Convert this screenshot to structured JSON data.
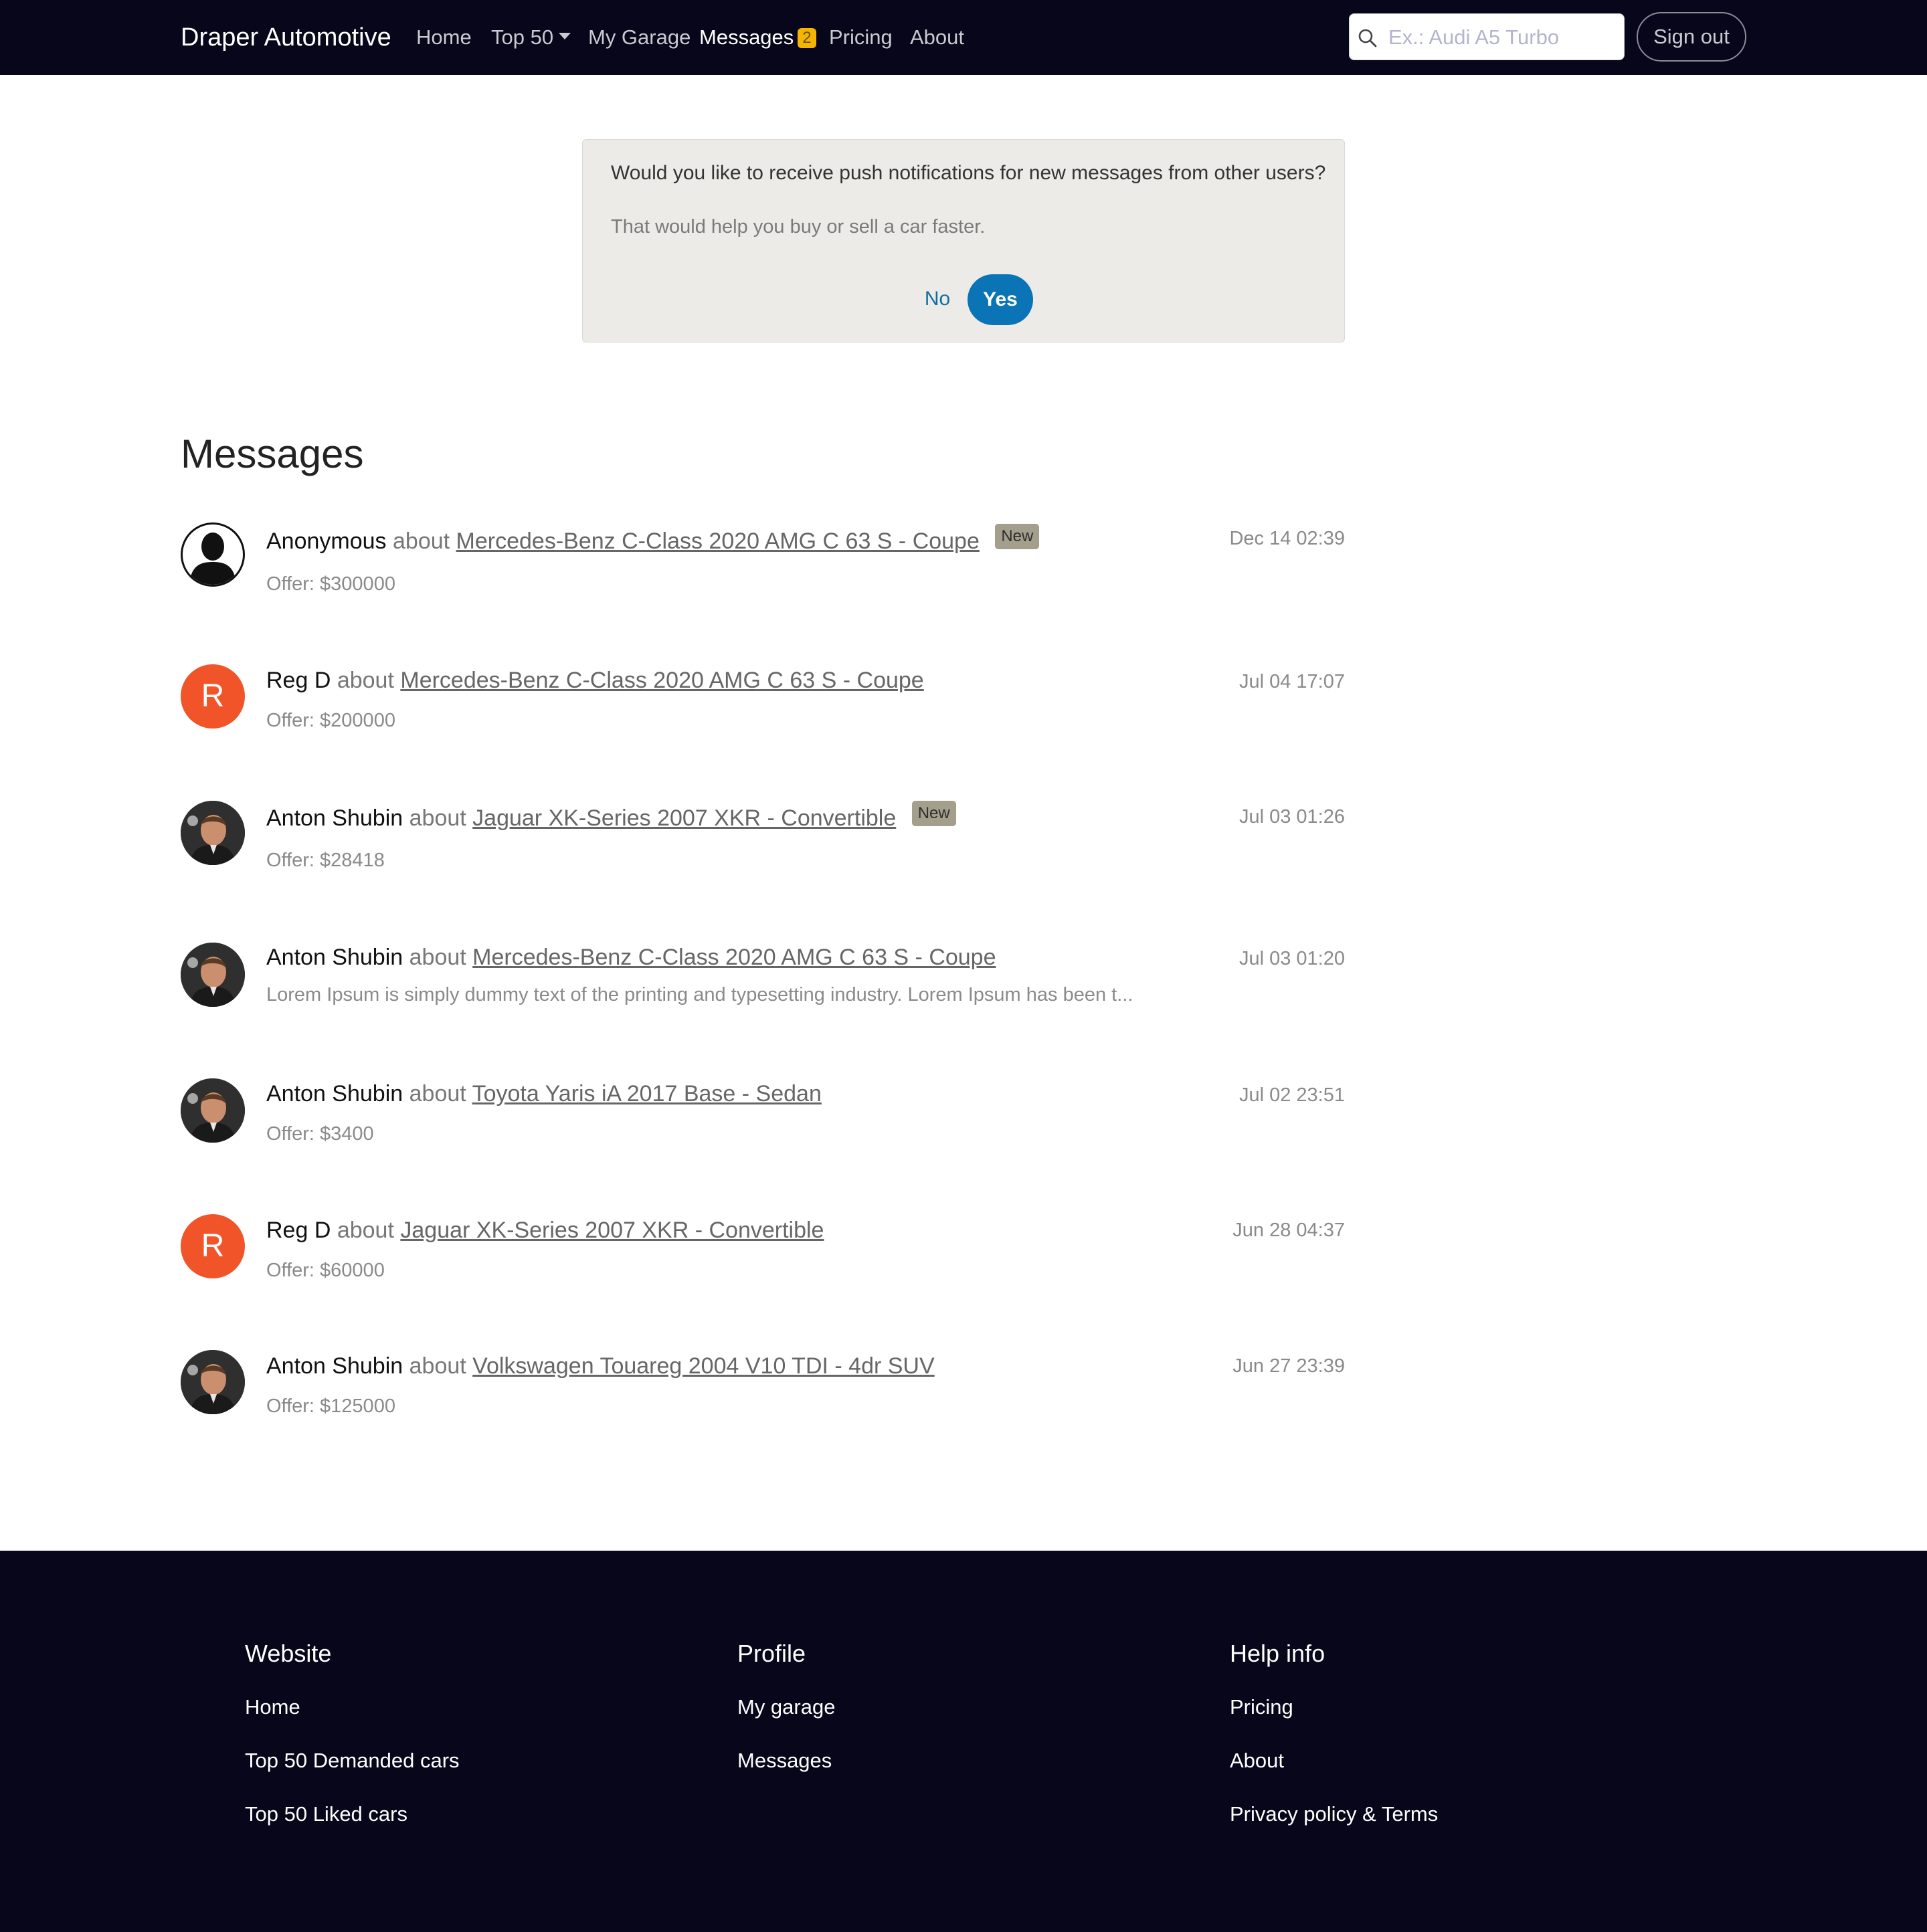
{
  "navbar": {
    "brand": "Draper Automotive",
    "links": [
      "Home",
      "Top 50",
      "My Garage",
      "Messages",
      "Pricing",
      "About"
    ],
    "messages_badge": "2",
    "search_placeholder": "Ex.: Audi A5 Turbo",
    "signout_label": "Sign out"
  },
  "notification": {
    "question": "Would you like to receive push notifications for new messages from other users?",
    "subtext": "That would help you buy or sell a car faster.",
    "no_label": "No",
    "yes_label": "Yes"
  },
  "messages": {
    "title": "Messages",
    "about_word": "about",
    "new_badge": "New",
    "items": [
      {
        "avatar": "anonymous-icon",
        "sender": "Anonymous",
        "car": "Mercedes-Benz C-Class 2020 AMG C 63 S - Coupe",
        "new": true,
        "sub": "Offer: $300000",
        "date": "Dec 14 02:39"
      },
      {
        "avatar": "R",
        "sender": "Reg D",
        "car": "Mercedes-Benz C-Class 2020 AMG C 63 S - Coupe",
        "new": false,
        "sub": "Offer: $200000",
        "date": "Jul 04 17:07"
      },
      {
        "avatar": "photo",
        "sender": "Anton Shubin",
        "car": "Jaguar XK-Series 2007 XKR - Convertible",
        "new": true,
        "sub": "Offer: $28418",
        "date": "Jul 03 01:26"
      },
      {
        "avatar": "photo",
        "sender": "Anton Shubin",
        "car": "Mercedes-Benz C-Class 2020 AMG C 63 S - Coupe",
        "new": false,
        "sub": "Lorem Ipsum is simply dummy text of the printing and typesetting industry. Lorem Ipsum has been t...",
        "date": "Jul 03 01:20"
      },
      {
        "avatar": "photo",
        "sender": "Anton Shubin",
        "car": "Toyota Yaris iA 2017 Base - Sedan",
        "new": false,
        "sub": "Offer: $3400",
        "date": "Jul 02 23:51"
      },
      {
        "avatar": "R",
        "sender": "Reg D",
        "car": "Jaguar XK-Series 2007 XKR - Convertible",
        "new": false,
        "sub": "Offer: $60000",
        "date": "Jun 28 04:37"
      },
      {
        "avatar": "photo",
        "sender": "Anton Shubin",
        "car": "Volkswagen Touareg 2004 V10 TDI - 4dr SUV",
        "new": false,
        "sub": "Offer: $125000",
        "date": "Jun 27 23:39"
      }
    ]
  },
  "footer": {
    "website": {
      "title": "Website",
      "links": [
        "Home",
        "Top 50 Demanded cars",
        "Top 50 Liked cars"
      ]
    },
    "profile": {
      "title": "Profile",
      "links": [
        "My garage",
        "Messages"
      ]
    },
    "help": {
      "title": "Help info",
      "links": [
        "Pricing",
        "About",
        "Privacy policy & Terms"
      ]
    }
  },
  "colors": {
    "nav_bg": "#07061a",
    "accent": "#0a74b6",
    "badge": "#f4b400",
    "avatar_letter_bg": "#f2542a",
    "new_badge": "#a49e8c"
  }
}
